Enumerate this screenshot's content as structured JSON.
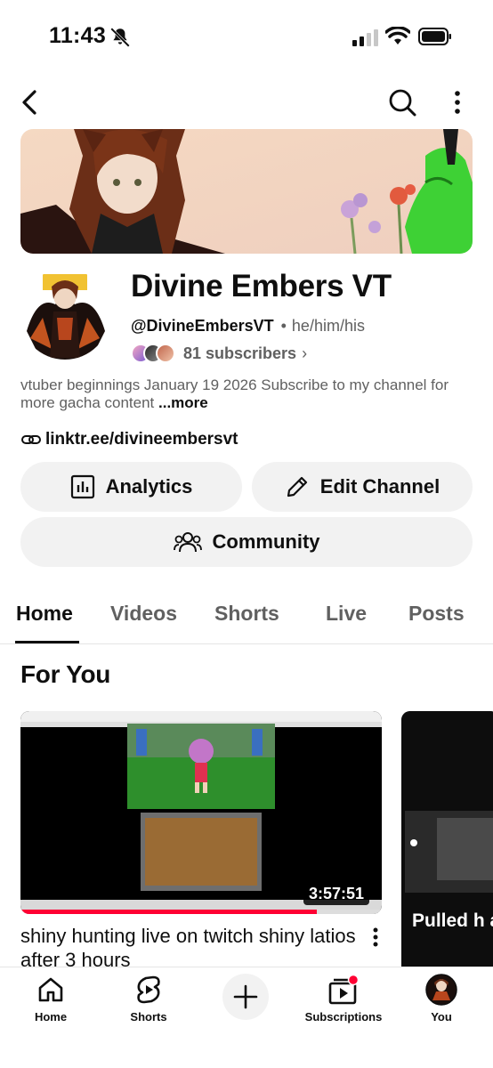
{
  "status_bar": {
    "time": "11:43"
  },
  "channel": {
    "name": "Divine Embers VT",
    "handle": "@DivineEmbersVT",
    "separator": "•",
    "pronouns": "he/him/his",
    "subscribers": "81 subscribers",
    "description": "vtuber beginnings January 19 2026 Subscribe to my channel for more gacha content",
    "more_label": "...more",
    "link": "linktr.ee/divineembersvt"
  },
  "buttons": {
    "analytics": "Analytics",
    "edit_channel": "Edit Channel",
    "community": "Community"
  },
  "tabs": [
    "Home",
    "Videos",
    "Shorts",
    "Live",
    "Posts"
  ],
  "section": {
    "title": "For You"
  },
  "video": {
    "duration": "3:57:51",
    "title": "shiny hunting live on twitch shiny latios after 3 hours",
    "progress_fraction": 0.82
  },
  "short": {
    "title": "Pulled h and wea"
  },
  "bottom_nav": {
    "home": "Home",
    "shorts": "Shorts",
    "subscriptions": "Subscriptions",
    "you": "You"
  },
  "colors": {
    "accent": "#ff0033",
    "chip_bg": "#f2f2f2",
    "secondary_text": "#606060"
  },
  "icons": [
    "bell-off-icon",
    "back-icon",
    "search-icon",
    "more-vert-icon",
    "link-icon",
    "analytics-icon",
    "pencil-icon",
    "community-icon",
    "kebab-icon",
    "home-icon",
    "shorts-icon",
    "plus-icon",
    "subscriptions-icon"
  ]
}
